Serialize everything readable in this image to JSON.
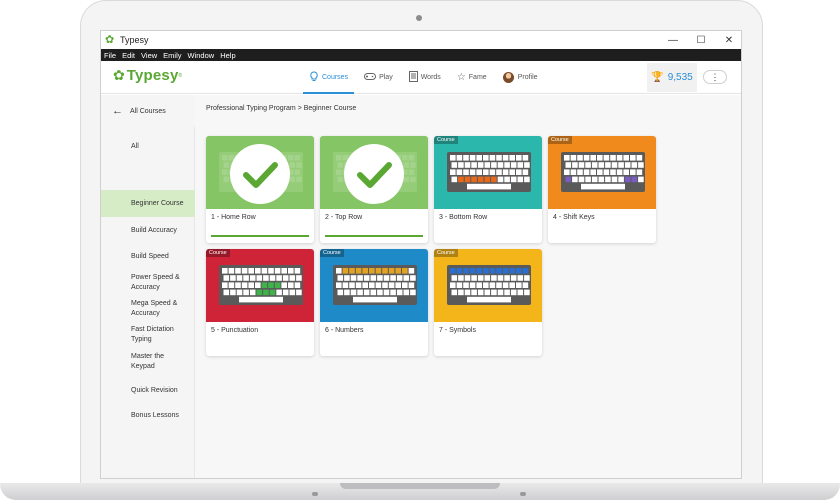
{
  "window": {
    "title": "Typesy",
    "minimize_label": "—",
    "maximize_label": "☐",
    "close_label": "✕"
  },
  "menu": [
    "File",
    "Edit",
    "View",
    "Emily",
    "Window",
    "Help"
  ],
  "header": {
    "brand": "Typesy",
    "brand_mark": "®",
    "nav": [
      {
        "label": "Courses",
        "icon": "lightbulb-icon"
      },
      {
        "label": "Play",
        "icon": "gamepad-icon"
      },
      {
        "label": "Words",
        "icon": "document-icon"
      },
      {
        "label": "Fame",
        "icon": "star-icon"
      },
      {
        "label": "Profile",
        "icon": "avatar"
      }
    ],
    "points": "9,535",
    "more_label": "⋮"
  },
  "sidebar": {
    "back_label": "All Courses",
    "items": [
      {
        "label": "All"
      },
      {
        "label": "Beginner Course"
      },
      {
        "label": "Build Accuracy"
      },
      {
        "label": "Build Speed"
      },
      {
        "label": "Power Speed & Accuracy"
      },
      {
        "label": "Mega Speed & Accuracy"
      },
      {
        "label": "Fast Dictation Typing"
      },
      {
        "label": "Master the Keypad"
      },
      {
        "label": "Quick Revision"
      },
      {
        "label": "Bonus Lessons"
      }
    ]
  },
  "main": {
    "breadcrumb": "Professional Typing Program > Beginner Course",
    "courses": [
      {
        "label": "1 - Home Row",
        "badge": "",
        "color": "#7ec25b",
        "completed": true
      },
      {
        "label": "2 - Top Row",
        "badge": "",
        "color": "#7ec25b",
        "completed": true
      },
      {
        "label": "3 - Bottom Row",
        "badge": "Course",
        "color": "#2bb7ac",
        "completed": false
      },
      {
        "label": "4 - Shift Keys",
        "badge": "Course",
        "color": "#f08a1c",
        "completed": false
      },
      {
        "label": "5 - Punctuation",
        "badge": "Course",
        "color": "#cf2338",
        "completed": false
      },
      {
        "label": "6 - Numbers",
        "badge": "Course",
        "color": "#1e8bc8",
        "completed": false
      },
      {
        "label": "7 - Symbols",
        "badge": "Course",
        "color": "#f4b51a",
        "completed": false
      }
    ]
  },
  "colors": {
    "accent_blue": "#2a8fd8",
    "brand_green": "#5aa833",
    "sidebar_active": "#d6ecc6"
  }
}
